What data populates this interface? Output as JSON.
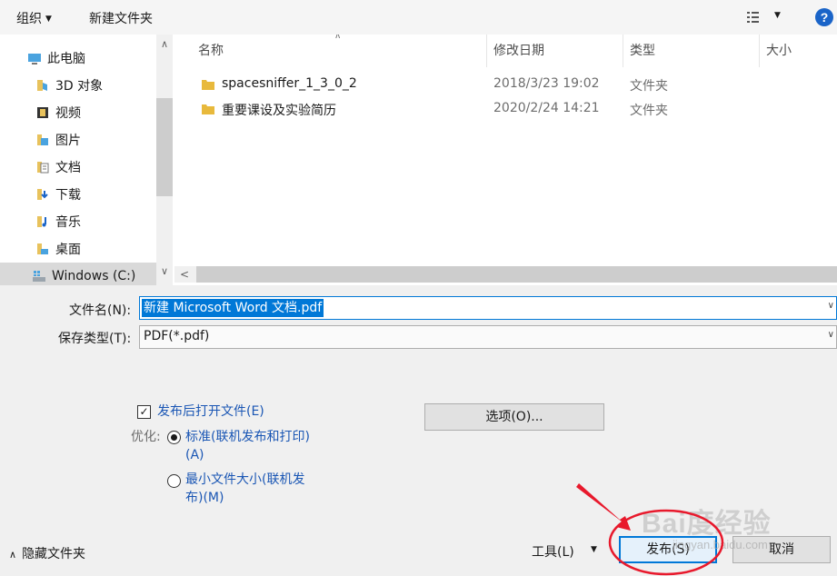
{
  "toolbar": {
    "organize": "组织",
    "new_folder": "新建文件夹",
    "help": "?"
  },
  "nav": {
    "items": [
      {
        "label": "此电脑",
        "icon": "pc-icon"
      },
      {
        "label": "3D 对象",
        "icon": "3d-objects-icon"
      },
      {
        "label": "视频",
        "icon": "video-icon"
      },
      {
        "label": "图片",
        "icon": "pictures-icon"
      },
      {
        "label": "文档",
        "icon": "documents-icon"
      },
      {
        "label": "下载",
        "icon": "downloads-icon"
      },
      {
        "label": "音乐",
        "icon": "music-icon"
      },
      {
        "label": "桌面",
        "icon": "desktop-icon"
      },
      {
        "label": "Windows (C:)",
        "icon": "drive-icon"
      }
    ]
  },
  "file_list": {
    "columns": {
      "name": "名称",
      "modified": "修改日期",
      "type": "类型",
      "size": "大小"
    },
    "rows": [
      {
        "name": "spacesniffer_1_3_0_2",
        "modified": "2018/3/23 19:02",
        "type": "文件夹"
      },
      {
        "name": "重要课设及实验简历",
        "modified": "2020/2/24 14:21",
        "type": "文件夹"
      }
    ]
  },
  "form": {
    "filename_label": "文件名(N):",
    "filename_value": "新建 Microsoft Word 文档.pdf",
    "filetype_label": "保存类型(T):",
    "filetype_value": "PDF(*.pdf)"
  },
  "options": {
    "open_after_publish": "发布后打开文件(E)",
    "open_after_publish_checked": true,
    "optimize_label": "优化:",
    "standard_line1": "标准(联机发布和打印)",
    "standard_line2": "(A)",
    "minimum_line1": "最小文件大小(联机发",
    "minimum_line2": "布)(M)",
    "options_button": "选项(O)..."
  },
  "footer": {
    "hide_folders": "隐藏文件夹",
    "tools": "工具(L)",
    "publish": "发布(S)",
    "cancel": "取消"
  },
  "annotation": {
    "watermark": "Bai度经验",
    "watermark_sub": "jingyan.baidu.com",
    "arrow_color": "#e8192c",
    "circle_color": "#e8192c"
  }
}
